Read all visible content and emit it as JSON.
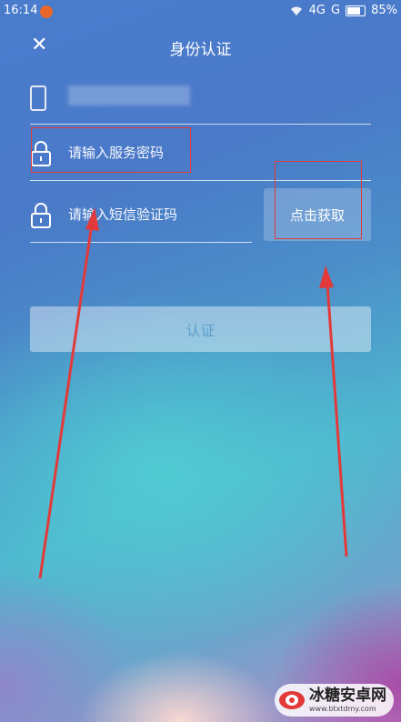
{
  "status_bar": {
    "time": "16:14",
    "network": "4G",
    "network2": "G",
    "battery": "85%"
  },
  "header": {
    "title": "身份认证",
    "close_icon": "close-icon"
  },
  "form": {
    "phone_icon": "phone-icon",
    "password_placeholder": "请输入服务密码",
    "sms_placeholder": "请输入短信验证码",
    "get_code_label": "点击获取",
    "submit_label": "认证"
  },
  "annotations": {
    "highlight_color": "#e23a3a",
    "arrow_color": "#e23a3a"
  },
  "watermark": {
    "name": "冰糖安卓网",
    "url": "www.btxtdmy.com"
  }
}
